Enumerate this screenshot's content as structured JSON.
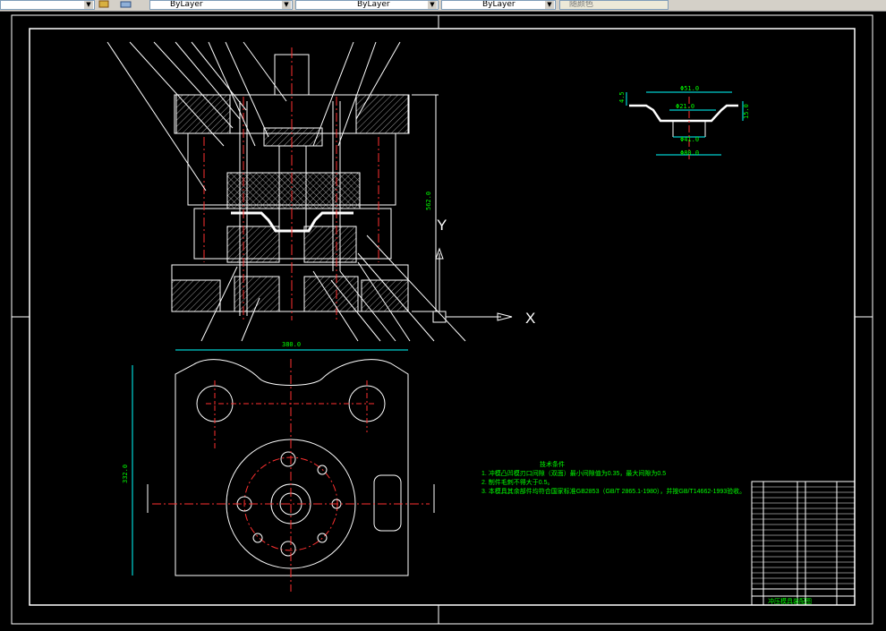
{
  "toolbar": {
    "linetype_value": "ByLayer",
    "lineweight_value": "ByLayer",
    "linecolor_value": "ByLayer",
    "plotstyle_value": "随颜色"
  },
  "drawing": {
    "dims": {
      "height_main": "562.0",
      "width_base": "380.0",
      "depth_base": "332.0",
      "part_top": "Φ51.0",
      "part_mid": "Φ21.0",
      "part_bottom": "Φ41.0",
      "part_flange": "Φ80.0",
      "part_h1": "4.5",
      "part_h2": "15.0"
    },
    "notes": {
      "title": "技术条件",
      "line1": "1. 冲模凸凹模刃口间隙（双面）最小间隙值为0.35，最大间隙为0.5",
      "line2": "2. 制件毛刺不得大于0.5。",
      "line3": "3. 本模具其余部件均符合国家标准GB2853（GB/T 2865.1-1980），并按GB/T14662-1993验收。"
    },
    "title_block": {
      "title": "冲压模具装配图"
    },
    "axis": {
      "x_label": "X",
      "y_label": "Y"
    }
  }
}
